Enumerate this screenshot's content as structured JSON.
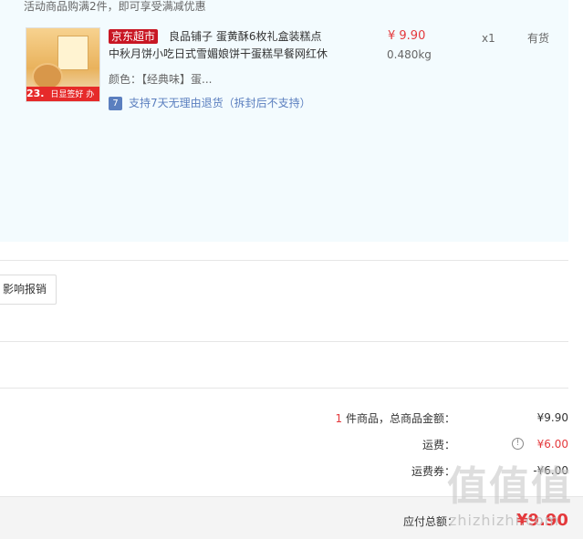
{
  "promo": {
    "text": "活动商品购满2件，即可享受满减优惠"
  },
  "product": {
    "thumb_price": "23.",
    "thumb_caption": "日显签好 办酥不腻",
    "store_badge": "京东超市",
    "title_line1": "良品铺子 蛋黄酥6枚礼盒装糕点",
    "title_line2": "中秋月饼小吃日式雪媚娘饼干蛋糕早餐网红休",
    "color_text": "颜色：【经典味】蛋...",
    "return_icon": "7",
    "return_text": "支持7天无理由退货（拆封后不支持）",
    "price": "¥ 9.90",
    "weight": "0.480kg",
    "quantity": "x1",
    "stock": "有货"
  },
  "invoice": {
    "button_label": "影响报销"
  },
  "summary": {
    "count": "1",
    "count_label": "件商品，总商品金额：",
    "total_value": "¥9.90",
    "shipping_label": "运费：",
    "shipping_value": "¥6.00",
    "coupon_label": "运费券：",
    "coupon_value": "-¥6.00"
  },
  "payment": {
    "label": "应付总额：",
    "value": "¥9.90"
  },
  "watermark": {
    "logo": "值值值",
    "url": "zhizhizhi.com"
  },
  "colors": {
    "accent_red": "#e4393c",
    "jd_red": "#c81623",
    "link_blue": "#5b7fbf",
    "panel_bg": "#f3fbfe"
  }
}
